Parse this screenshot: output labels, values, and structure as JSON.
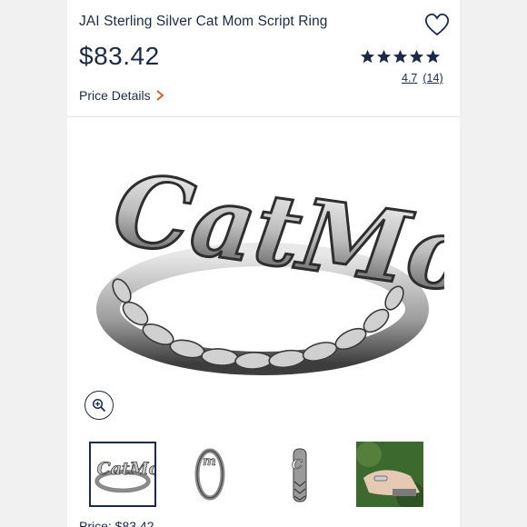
{
  "product": {
    "title": "JAI Sterling Silver Cat Mom Script Ring",
    "price": "$83.42",
    "price_details_label": "Price Details",
    "rating_value": "4.7",
    "rating_count": "(14)",
    "stars": 5,
    "engraving_text": "CatMom"
  },
  "thumbnails": [
    {
      "name": "front view",
      "selected": true
    },
    {
      "name": "side view",
      "selected": false
    },
    {
      "name": "end view",
      "selected": false
    },
    {
      "name": "worn on hand",
      "selected": false
    }
  ],
  "footer": {
    "price_line": "Price: $83.42"
  },
  "icons": {
    "favorite": "heart-icon",
    "zoom": "zoom-in-icon",
    "chevron": "chevron-right-icon",
    "star": "star-icon"
  },
  "colors": {
    "text": "#1b2a4a",
    "accent": "#e0592a",
    "page_bg": "#f1f1f1"
  }
}
